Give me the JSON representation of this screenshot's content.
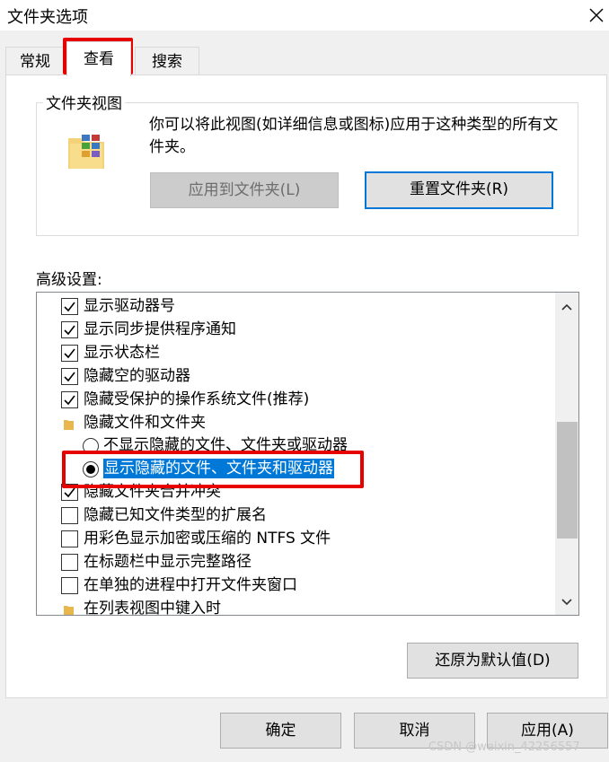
{
  "window": {
    "title": "文件夹选项",
    "close_icon": "close-icon"
  },
  "tabs": [
    {
      "label": "常规",
      "active": false
    },
    {
      "label": "查看",
      "active": true
    },
    {
      "label": "搜索",
      "active": false
    }
  ],
  "folder_views": {
    "group_title": "文件夹视图",
    "description": "你可以将此视图(如详细信息或图标)应用于这种类型的所有文件夹。",
    "apply_button": "应用到文件夹(L)",
    "reset_button": "重置文件夹(R)"
  },
  "advanced": {
    "label": "高级设置:",
    "items": [
      {
        "type": "checkbox",
        "checked": true,
        "label": "显示驱动器号"
      },
      {
        "type": "checkbox",
        "checked": true,
        "label": "显示同步提供程序通知"
      },
      {
        "type": "checkbox",
        "checked": true,
        "label": "显示状态栏"
      },
      {
        "type": "checkbox",
        "checked": true,
        "label": "隐藏空的驱动器"
      },
      {
        "type": "checkbox",
        "checked": true,
        "label": "隐藏受保护的操作系统文件(推荐)"
      },
      {
        "type": "folder",
        "label": "隐藏文件和文件夹"
      },
      {
        "type": "radio",
        "checked": false,
        "label": "不显示隐藏的文件、文件夹或驱动器"
      },
      {
        "type": "radio",
        "checked": true,
        "selected": true,
        "label": "显示隐藏的文件、文件夹和驱动器"
      },
      {
        "type": "checkbox",
        "checked": true,
        "label": "隐藏文件夹合并冲突"
      },
      {
        "type": "checkbox",
        "checked": false,
        "label": "隐藏已知文件类型的扩展名"
      },
      {
        "type": "checkbox",
        "checked": false,
        "label": "用彩色显示加密或压缩的 NTFS 文件"
      },
      {
        "type": "checkbox",
        "checked": false,
        "label": "在标题栏中显示完整路径"
      },
      {
        "type": "checkbox",
        "checked": false,
        "label": "在单独的进程中打开文件夹窗口"
      },
      {
        "type": "folder",
        "label": "在列表视图中键入时"
      }
    ],
    "restore_defaults_button": "还原为默认值(D)"
  },
  "footer": {
    "ok_button": "确定",
    "cancel_button": "取消",
    "apply_button": "应用(A)"
  },
  "watermark": "CSDN @weixin_42256557",
  "colors": {
    "highlight": "#0078d7",
    "annotation_red": "#e60000"
  }
}
